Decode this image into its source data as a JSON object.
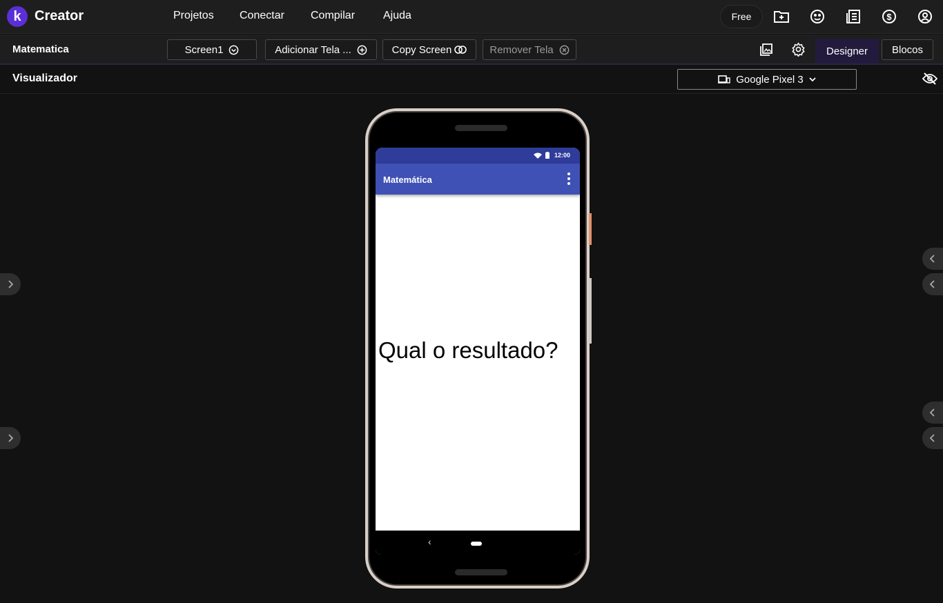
{
  "app": {
    "logo_letter": "k",
    "brand": "Creator",
    "accent": "#5b2fd6"
  },
  "nav": {
    "items": [
      "Projetos",
      "Conectar",
      "Compilar",
      "Ajuda"
    ],
    "plan": "Free",
    "icons": [
      "new-project-icon",
      "gallery-icon",
      "news-icon",
      "dollar-icon",
      "account-icon"
    ]
  },
  "toolbar": {
    "project_name": "Matematica",
    "screen_select": "Screen1",
    "add_screen": "Adicionar Tela ...",
    "copy_screen": "Copy Screen",
    "remove_screen": "Remover Tela",
    "designer": "Designer",
    "blocks": "Blocos"
  },
  "viewer": {
    "title": "Visualizador",
    "device": "Google Pixel 3"
  },
  "phone": {
    "status_time": "12:00",
    "app_title": "Matemática",
    "label_text": "Qual o resultado?",
    "appbar_color": "#3f51b5",
    "statusbar_color": "#2f3c9a"
  }
}
